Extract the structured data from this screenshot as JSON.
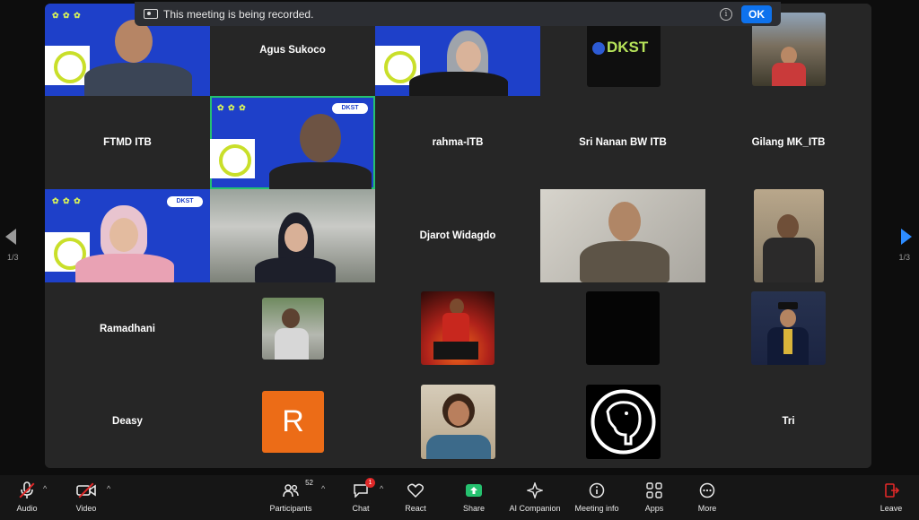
{
  "banner": {
    "message": "This meeting is being recorded.",
    "ok_label": "OK"
  },
  "nav": {
    "page_left": "1/3",
    "page_right": "1/3"
  },
  "participants": {
    "agus": "Agus Sukoco",
    "ftmd": "FTMD ITB",
    "rahma": "rahma-ITB",
    "sri": "Sri Nanan BW ITB",
    "gilang": "Gilang MK_ITB",
    "djarot": "Djarot Widagdo",
    "ramadhani": "Ramadhani",
    "deasy": "Deasy",
    "tri": "Tri"
  },
  "tiles": {
    "dkst_logo": "DKST",
    "dkst_pill": "DKST",
    "avatar_letter": "R"
  },
  "toolbar": {
    "audio": "Audio",
    "video": "Video",
    "participants": "Participants",
    "participants_count": "52",
    "chat": "Chat",
    "chat_badge": "1",
    "react": "React",
    "share": "Share",
    "ai_companion": "AI Companion",
    "meeting_info": "Meeting info",
    "apps": "Apps",
    "more": "More",
    "leave": "Leave"
  },
  "colors": {
    "accent": "#0e72ed",
    "share_green": "#25c16f",
    "leave_red": "#e02828",
    "tile_blue": "#1e40c9"
  }
}
